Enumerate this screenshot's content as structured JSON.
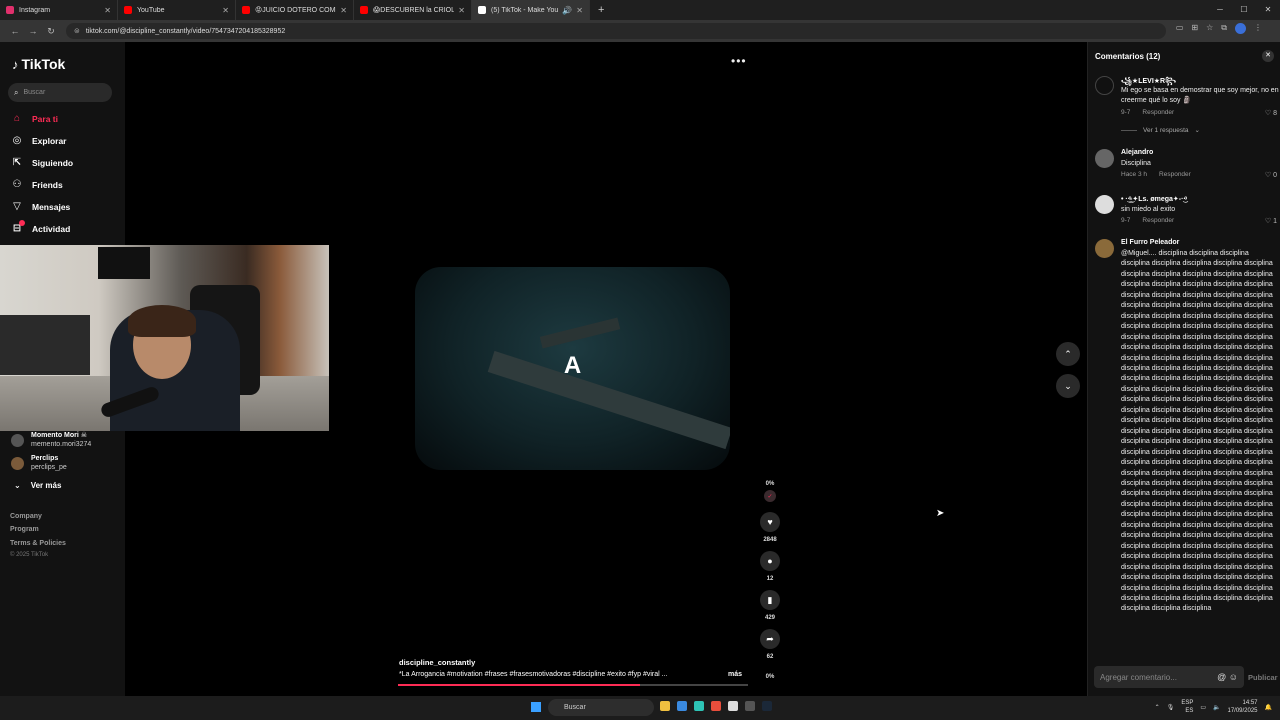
{
  "browser": {
    "tabs": [
      {
        "title": "Instagram",
        "color": "#e1306c",
        "active": false
      },
      {
        "title": "YouTube",
        "color": "#ff0000",
        "active": false
      },
      {
        "title": "😡JUICIO DOTERO COMPLETO",
        "color": "#ff0000",
        "active": false
      },
      {
        "title": "😱DESCUBREN la CRIOLLADA",
        "color": "#ff0000",
        "active": false
      },
      {
        "title": "(5) TikTok - Make Your Day",
        "color": "#ffffff",
        "active": true
      }
    ],
    "url": "tiktok.com/@discipline_constantly/video/7547347204185328952"
  },
  "sidebar": {
    "logo": "TikTok",
    "search_placeholder": "Buscar",
    "nav": [
      {
        "label": "Para ti",
        "icon": "home-icon",
        "active": true
      },
      {
        "label": "Explorar",
        "icon": "compass-icon",
        "active": false
      },
      {
        "label": "Siguiendo",
        "icon": "following-icon",
        "active": false
      },
      {
        "label": "Friends",
        "icon": "friends-icon",
        "active": false
      },
      {
        "label": "Mensajes",
        "icon": "send-icon",
        "active": false
      },
      {
        "label": "Actividad",
        "icon": "activity-icon",
        "active": false
      }
    ],
    "following": [
      {
        "name": "Momento Mori ☠",
        "handle": "memento.mori3274"
      },
      {
        "name": "Perclips",
        "handle": "perclips_pe"
      }
    ],
    "ver_mas": "Ver más",
    "footer": [
      "Company",
      "Program",
      "Terms & Policies"
    ],
    "copyright": "© 2025 TikTok"
  },
  "video": {
    "overlay_text": "A",
    "author": "discipline_constantly",
    "caption": "*La Arrogancia #motivation #frases #frasesmotivadoras #discipline #exito #fyp #viral ...",
    "caption_more": "más",
    "progress": 0.69,
    "actions": {
      "likes": "2848",
      "comments": "12",
      "saves": "429",
      "shares": "62"
    },
    "top_percent": "0%",
    "bottom_percent": "0%"
  },
  "comments": {
    "title": "Comentarios (12)",
    "items": [
      {
        "user": "꧁★LEVI★R꧂",
        "text": "Mi ego se basa en demostrar que soy mejor, no en creerme qué lo soy 🗿",
        "date": "9-7",
        "reply": "Responder",
        "likes": "8"
      },
      {
        "user": "Alejandro",
        "text": "Disciplina",
        "date": "Hace 3 h",
        "reply": "Responder",
        "likes": "0"
      },
      {
        "user": "• ·͜·ͦ͜-✦Ls. ømega✦-·͜·ͦ",
        "text": "sin miedo al exito",
        "date": "9-7",
        "reply": "Responder",
        "likes": "1"
      },
      {
        "user": "El Furro Peleador",
        "text": "@Miguel.... disciplina disciplina disciplina disciplina disciplina disciplina disciplina disciplina disciplina disciplina disciplina disciplina disciplina disciplina disciplina disciplina disciplina disciplina disciplina disciplina disciplina disciplina disciplina disciplina disciplina disciplina disciplina disciplina disciplina disciplina disciplina disciplina disciplina disciplina disciplina disciplina disciplina disciplina disciplina disciplina disciplina disciplina disciplina disciplina disciplina disciplina disciplina disciplina disciplina disciplina disciplina disciplina disciplina disciplina disciplina disciplina disciplina disciplina disciplina disciplina disciplina disciplina disciplina disciplina disciplina disciplina disciplina disciplina disciplina disciplina disciplina disciplina disciplina disciplina disciplina disciplina disciplina disciplina disciplina disciplina disciplina disciplina disciplina disciplina disciplina disciplina disciplina disciplina disciplina disciplina disciplina disciplina disciplina disciplina disciplina disciplina disciplina disciplina disciplina disciplina disciplina disciplina disciplina disciplina disciplina disciplina disciplina disciplina disciplina disciplina disciplina disciplina disciplina disciplina disciplina disciplina disciplina disciplina disciplina disciplina disciplina disciplina disciplina disciplina disciplina disciplina disciplina disciplina disciplina disciplina disciplina disciplina disciplina disciplina disciplina disciplina disciplina disciplina disciplina disciplina disciplina disciplina disciplina disciplina disciplina disciplina disciplina disciplina disciplina disciplina disciplina disciplina disciplina disciplina disciplina disciplina disciplina disciplina disciplina disciplina disciplina disciplina disciplina disciplina disciplina disciplina disciplina disciplina disciplina disciplina disciplina"
      }
    ],
    "view_replies": "Ver 1 respuesta",
    "input_placeholder": "Agregar comentario...",
    "publish": "Publicar"
  },
  "taskbar": {
    "search": "Buscar",
    "lang": "ESP",
    "region": "ES",
    "time": "14:57",
    "date": "17/09/2025"
  }
}
